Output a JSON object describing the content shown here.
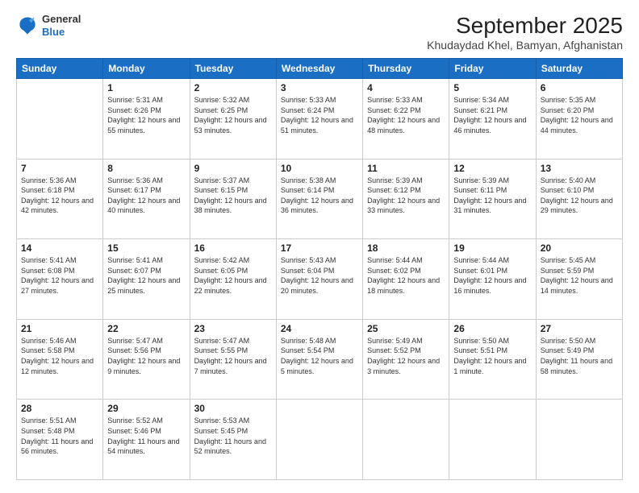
{
  "header": {
    "logo_general": "General",
    "logo_blue": "Blue",
    "month": "September 2025",
    "location": "Khudaydad Khel, Bamyan, Afghanistan"
  },
  "weekdays": [
    "Sunday",
    "Monday",
    "Tuesday",
    "Wednesday",
    "Thursday",
    "Friday",
    "Saturday"
  ],
  "weeks": [
    [
      {
        "num": "",
        "sunrise": "",
        "sunset": "",
        "daylight": ""
      },
      {
        "num": "1",
        "sunrise": "Sunrise: 5:31 AM",
        "sunset": "Sunset: 6:26 PM",
        "daylight": "Daylight: 12 hours and 55 minutes."
      },
      {
        "num": "2",
        "sunrise": "Sunrise: 5:32 AM",
        "sunset": "Sunset: 6:25 PM",
        "daylight": "Daylight: 12 hours and 53 minutes."
      },
      {
        "num": "3",
        "sunrise": "Sunrise: 5:33 AM",
        "sunset": "Sunset: 6:24 PM",
        "daylight": "Daylight: 12 hours and 51 minutes."
      },
      {
        "num": "4",
        "sunrise": "Sunrise: 5:33 AM",
        "sunset": "Sunset: 6:22 PM",
        "daylight": "Daylight: 12 hours and 48 minutes."
      },
      {
        "num": "5",
        "sunrise": "Sunrise: 5:34 AM",
        "sunset": "Sunset: 6:21 PM",
        "daylight": "Daylight: 12 hours and 46 minutes."
      },
      {
        "num": "6",
        "sunrise": "Sunrise: 5:35 AM",
        "sunset": "Sunset: 6:20 PM",
        "daylight": "Daylight: 12 hours and 44 minutes."
      }
    ],
    [
      {
        "num": "7",
        "sunrise": "Sunrise: 5:36 AM",
        "sunset": "Sunset: 6:18 PM",
        "daylight": "Daylight: 12 hours and 42 minutes."
      },
      {
        "num": "8",
        "sunrise": "Sunrise: 5:36 AM",
        "sunset": "Sunset: 6:17 PM",
        "daylight": "Daylight: 12 hours and 40 minutes."
      },
      {
        "num": "9",
        "sunrise": "Sunrise: 5:37 AM",
        "sunset": "Sunset: 6:15 PM",
        "daylight": "Daylight: 12 hours and 38 minutes."
      },
      {
        "num": "10",
        "sunrise": "Sunrise: 5:38 AM",
        "sunset": "Sunset: 6:14 PM",
        "daylight": "Daylight: 12 hours and 36 minutes."
      },
      {
        "num": "11",
        "sunrise": "Sunrise: 5:39 AM",
        "sunset": "Sunset: 6:12 PM",
        "daylight": "Daylight: 12 hours and 33 minutes."
      },
      {
        "num": "12",
        "sunrise": "Sunrise: 5:39 AM",
        "sunset": "Sunset: 6:11 PM",
        "daylight": "Daylight: 12 hours and 31 minutes."
      },
      {
        "num": "13",
        "sunrise": "Sunrise: 5:40 AM",
        "sunset": "Sunset: 6:10 PM",
        "daylight": "Daylight: 12 hours and 29 minutes."
      }
    ],
    [
      {
        "num": "14",
        "sunrise": "Sunrise: 5:41 AM",
        "sunset": "Sunset: 6:08 PM",
        "daylight": "Daylight: 12 hours and 27 minutes."
      },
      {
        "num": "15",
        "sunrise": "Sunrise: 5:41 AM",
        "sunset": "Sunset: 6:07 PM",
        "daylight": "Daylight: 12 hours and 25 minutes."
      },
      {
        "num": "16",
        "sunrise": "Sunrise: 5:42 AM",
        "sunset": "Sunset: 6:05 PM",
        "daylight": "Daylight: 12 hours and 22 minutes."
      },
      {
        "num": "17",
        "sunrise": "Sunrise: 5:43 AM",
        "sunset": "Sunset: 6:04 PM",
        "daylight": "Daylight: 12 hours and 20 minutes."
      },
      {
        "num": "18",
        "sunrise": "Sunrise: 5:44 AM",
        "sunset": "Sunset: 6:02 PM",
        "daylight": "Daylight: 12 hours and 18 minutes."
      },
      {
        "num": "19",
        "sunrise": "Sunrise: 5:44 AM",
        "sunset": "Sunset: 6:01 PM",
        "daylight": "Daylight: 12 hours and 16 minutes."
      },
      {
        "num": "20",
        "sunrise": "Sunrise: 5:45 AM",
        "sunset": "Sunset: 5:59 PM",
        "daylight": "Daylight: 12 hours and 14 minutes."
      }
    ],
    [
      {
        "num": "21",
        "sunrise": "Sunrise: 5:46 AM",
        "sunset": "Sunset: 5:58 PM",
        "daylight": "Daylight: 12 hours and 12 minutes."
      },
      {
        "num": "22",
        "sunrise": "Sunrise: 5:47 AM",
        "sunset": "Sunset: 5:56 PM",
        "daylight": "Daylight: 12 hours and 9 minutes."
      },
      {
        "num": "23",
        "sunrise": "Sunrise: 5:47 AM",
        "sunset": "Sunset: 5:55 PM",
        "daylight": "Daylight: 12 hours and 7 minutes."
      },
      {
        "num": "24",
        "sunrise": "Sunrise: 5:48 AM",
        "sunset": "Sunset: 5:54 PM",
        "daylight": "Daylight: 12 hours and 5 minutes."
      },
      {
        "num": "25",
        "sunrise": "Sunrise: 5:49 AM",
        "sunset": "Sunset: 5:52 PM",
        "daylight": "Daylight: 12 hours and 3 minutes."
      },
      {
        "num": "26",
        "sunrise": "Sunrise: 5:50 AM",
        "sunset": "Sunset: 5:51 PM",
        "daylight": "Daylight: 12 hours and 1 minute."
      },
      {
        "num": "27",
        "sunrise": "Sunrise: 5:50 AM",
        "sunset": "Sunset: 5:49 PM",
        "daylight": "Daylight: 11 hours and 58 minutes."
      }
    ],
    [
      {
        "num": "28",
        "sunrise": "Sunrise: 5:51 AM",
        "sunset": "Sunset: 5:48 PM",
        "daylight": "Daylight: 11 hours and 56 minutes."
      },
      {
        "num": "29",
        "sunrise": "Sunrise: 5:52 AM",
        "sunset": "Sunset: 5:46 PM",
        "daylight": "Daylight: 11 hours and 54 minutes."
      },
      {
        "num": "30",
        "sunrise": "Sunrise: 5:53 AM",
        "sunset": "Sunset: 5:45 PM",
        "daylight": "Daylight: 11 hours and 52 minutes."
      },
      {
        "num": "",
        "sunrise": "",
        "sunset": "",
        "daylight": ""
      },
      {
        "num": "",
        "sunrise": "",
        "sunset": "",
        "daylight": ""
      },
      {
        "num": "",
        "sunrise": "",
        "sunset": "",
        "daylight": ""
      },
      {
        "num": "",
        "sunrise": "",
        "sunset": "",
        "daylight": ""
      }
    ]
  ]
}
